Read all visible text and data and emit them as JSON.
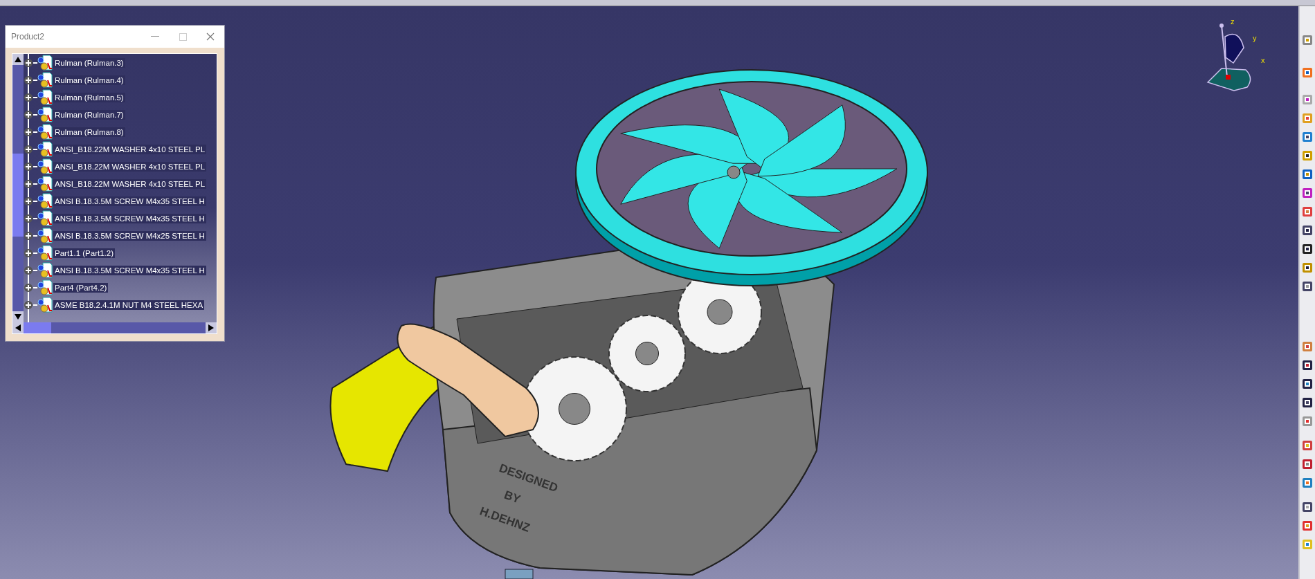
{
  "window": {
    "title": "Product2"
  },
  "tree": {
    "items": [
      {
        "label": "Rulman (Rulman.3)",
        "expanded": false
      },
      {
        "label": "Rulman (Rulman.4)",
        "expanded": false
      },
      {
        "label": "Rulman (Rulman.5)",
        "expanded": false
      },
      {
        "label": "Rulman (Rulman.7)",
        "expanded": false
      },
      {
        "label": "Rulman (Rulman.8)",
        "expanded": false
      },
      {
        "label": "ANSI_B18.22M WASHER 4x10 STEEL PL",
        "expanded": false
      },
      {
        "label": "ANSI_B18.22M WASHER 4x10 STEEL PL",
        "expanded": false
      },
      {
        "label": "ANSI_B18.22M WASHER 4x10 STEEL PL",
        "expanded": false
      },
      {
        "label": "ANSI B.18.3.5M SCREW M4x35 STEEL H",
        "expanded": false
      },
      {
        "label": "ANSI B.18.3.5M SCREW M4x35 STEEL H",
        "expanded": false
      },
      {
        "label": "ANSI B.18.3.5M SCREW M4x25 STEEL H",
        "expanded": false
      },
      {
        "label": "Part1.1 (Part1.2)",
        "expanded": false
      },
      {
        "label": "ANSI B.18.3.5M SCREW M4x35 STEEL H",
        "expanded": false
      },
      {
        "label": "Part4 (Part4.2)",
        "expanded": false
      },
      {
        "label": "ASME B18.2.4.1M NUT M4 STEEL HEXA",
        "expanded": false
      }
    ]
  },
  "viewport": {
    "engraved_text": [
      "DESIGNED",
      "BY",
      "H.DEHNZ"
    ],
    "compass_axes": [
      "z",
      "y",
      "x"
    ]
  }
}
